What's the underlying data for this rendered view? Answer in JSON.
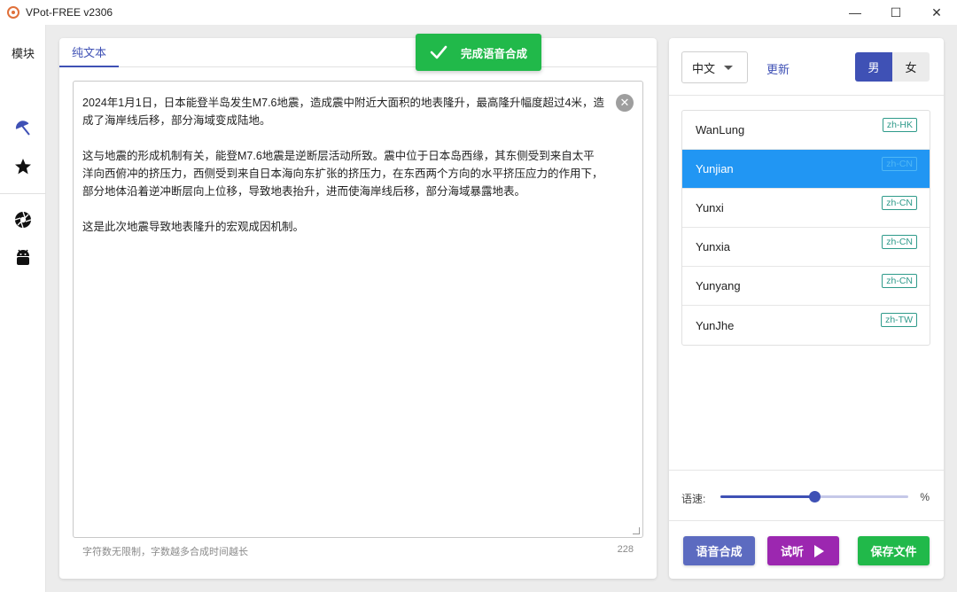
{
  "window": {
    "title": "VPot-FREE v2306",
    "minimize": "—",
    "maximize": "☐",
    "close": "✕"
  },
  "sidebar": {
    "label": "模块",
    "icons": [
      "umbrella-icon",
      "star-icon",
      "aperture-icon",
      "android-icon"
    ]
  },
  "main": {
    "tab_label": "纯文本",
    "text": "2024年1月1日，日本能登半岛发生M7.6地震，造成震中附近大面积的地表隆升，最高隆升幅度超过4米，造成了海岸线后移，部分海域变成陆地。\n\n这与地震的形成机制有关，能登M7.6地震是逆断层活动所致。震中位于日本岛西缘，其东侧受到来自太平洋向西俯冲的挤压力，西侧受到来自日本海向东扩张的挤压力，在东西两个方向的水平挤压应力的作用下，部分地体沿着逆冲断层向上位移，导致地表抬升，进而使海岸线后移，部分海域暴露地表。\n\n这是此次地震导致地表隆升的宏观成因机制。",
    "hint": "字符数无限制，字数越多合成时间越长",
    "char_count": "228"
  },
  "toast": {
    "text": "完成语音合成",
    "color": "#21b94a"
  },
  "right": {
    "language": "中文",
    "refresh_label": "更新",
    "gender_male": "男",
    "gender_female": "女",
    "selected_gender": "男",
    "voices": [
      {
        "name": "WanLung",
        "tag": "zh-HK",
        "selected": false
      },
      {
        "name": "Yunjian",
        "tag": "zh-CN",
        "selected": true
      },
      {
        "name": "Yunxi",
        "tag": "zh-CN",
        "selected": false
      },
      {
        "name": "Yunxia",
        "tag": "zh-CN",
        "selected": false
      },
      {
        "name": "Yunyang",
        "tag": "zh-CN",
        "selected": false
      },
      {
        "name": "YunJhe",
        "tag": "zh-TW",
        "selected": false
      }
    ],
    "speed_label": "语速:",
    "speed_unit": "%",
    "speed_fraction": 0.5,
    "btn_synth": "语音合成",
    "btn_listen": "试听",
    "btn_save": "保存文件"
  },
  "colors": {
    "primary": "#3f51b5",
    "selected_row": "#2196f3",
    "listen": "#9c27b0",
    "success": "#21b94a"
  }
}
